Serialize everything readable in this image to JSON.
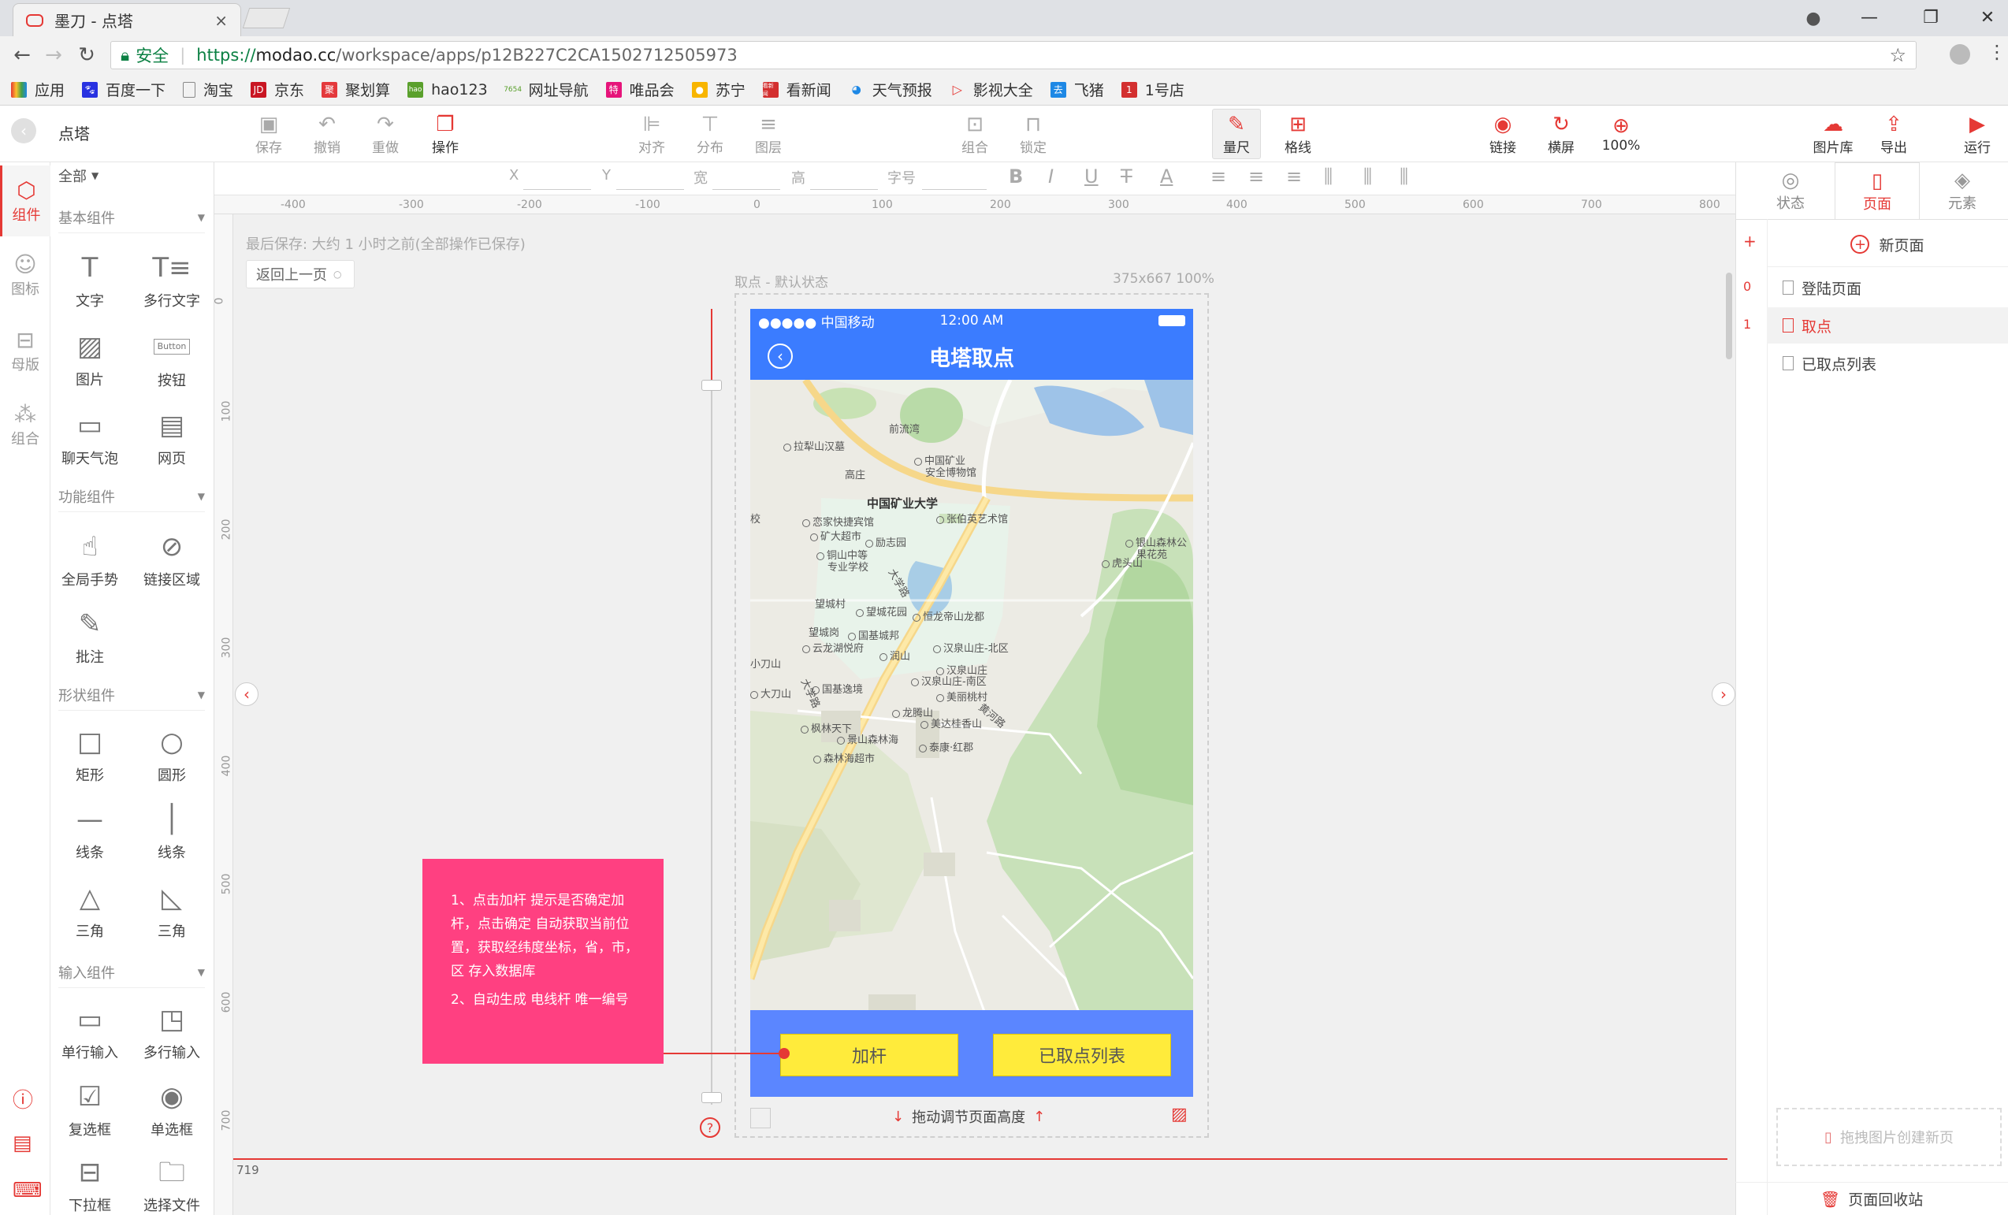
{
  "browser": {
    "tab_title": "墨刀 - 点塔",
    "secure_label": "安全",
    "url_scheme": "https://",
    "url_host": "modao.cc",
    "url_path": "/workspace/apps/p12B227C2CA1502712505973",
    "bookmarks": [
      "应用",
      "百度一下",
      "淘宝",
      "京东",
      "聚划算",
      "hao123",
      "网址导航",
      "唯品会",
      "苏宁",
      "看新闻",
      "天气预报",
      "影视大全",
      "飞猪",
      "1号店"
    ],
    "bookmark_badges": {
      "jd": "JD",
      "juhuasuan": "聚",
      "hao123": "hao",
      "wangzhi": "7654",
      "weipinhui": "特",
      "kanxinwen": "看新闻",
      "feizhu": "去",
      "yihaodian": "1"
    }
  },
  "app": {
    "project_name": "点塔",
    "toolbar": {
      "save": "保存",
      "undo": "撤销",
      "redo": "重做",
      "operate": "操作",
      "align": "对齐",
      "distribute": "分布",
      "layer": "图层",
      "group": "组合",
      "lock": "锁定",
      "ruler": "量尺",
      "grid": "格线",
      "link": "链接",
      "landscape": "横屏",
      "zoom": "100%",
      "image_lib": "图片库",
      "export": "导出",
      "run": "运行"
    },
    "left_tabs": [
      "组件",
      "图标",
      "母版",
      "组合"
    ],
    "filter": "全部",
    "sections": {
      "basic": {
        "title": "基本组件",
        "items": [
          "文字",
          "多行文字",
          "图片",
          "按钮",
          "聊天气泡",
          "网页"
        ],
        "button_icon_text": "Button"
      },
      "function": {
        "title": "功能组件",
        "items": [
          "全局手势",
          "链接区域",
          "批注"
        ]
      },
      "shape": {
        "title": "形状组件",
        "items": [
          "矩形",
          "圆形",
          "线条",
          "线条",
          "三角",
          "三角"
        ]
      },
      "input": {
        "title": "输入组件",
        "items": [
          "单行输入",
          "多行输入",
          "复选框",
          "单选框",
          "下拉框",
          "选择文件"
        ]
      }
    },
    "props": {
      "x": "X",
      "y": "Y",
      "w": "宽",
      "h": "高",
      "font_size": "字号",
      "bold": "B",
      "italic": "I",
      "underline": "U",
      "strike": "T",
      "color": "A"
    },
    "ruler_h": [
      "-400",
      "-300",
      "-200",
      "-100",
      "0",
      "100",
      "200",
      "300",
      "400",
      "500",
      "600",
      "700",
      "800"
    ],
    "ruler_v": [
      "0",
      "100",
      "200",
      "300",
      "400",
      "500",
      "600",
      "700"
    ],
    "save_status": "最后保存: 大约 1 小时之前(全部操作已保存)",
    "back_prev": "返回上一页",
    "artboard_label": "取点 - 默认状态",
    "artboard_size": "375x667 100%",
    "adjust_height": "拖动调节页面高度",
    "height_value": "719",
    "help": "?"
  },
  "phone": {
    "carrier": "●●●●● 中国移动",
    "time": "12:00 AM",
    "title": "电塔取点",
    "map_labels": {
      "qianliuwan": "前流湾",
      "lalishan": "拉犁山汉墓",
      "chinamine_museum_1": "中国矿业",
      "chinamine_museum_2": "安全博物馆",
      "gaozhuang": "高庄",
      "cumt": "中国矿业大学",
      "zhangboying": "张伯英艺术馆",
      "lianjia": "恋家快捷宾馆",
      "kuangda": "矿大超市",
      "lizhiyuan": "励志园",
      "tongshan_school_1": "铜山中等",
      "tongshan_school_2": "专业学校",
      "yinshan_1": "银山森林公",
      "yinshan_2": "果花苑",
      "hushan": "虎头山",
      "daxuelu": "大学路",
      "xiao": "校",
      "wangchengcun": "望城村",
      "wangchenghuayuan": "望城花园",
      "henglong": "恒龙帝山龙都",
      "wangchenggang": "望城岗",
      "guoji": "国基城邦",
      "yunlong": "云龙湖悦府",
      "hanquan_north": "汉泉山庄-北区",
      "runshan": "润山",
      "xiaodashan": "小刀山",
      "hanquan": "汉泉山庄",
      "hanquan_south": "汉泉山庄-南区",
      "guoji_yi": "国基逸境",
      "dadashan": "大刀山",
      "meiyuan": "美丽桃村",
      "longteng": "龙腾山",
      "huanghelu": "黄河路",
      "meidaxing": "美达桂香山",
      "fenglin": "枫林天下",
      "jingshan": "景山森林海",
      "taikang": "泰康·红郡",
      "senlinhai": "森林海超市",
      "daxuelu2": "大学路"
    },
    "btn_add": "加杆",
    "btn_list": "已取点列表"
  },
  "note": {
    "line1": "1、点击加杆 提示是否确定加杆，点击确定 自动获取当前位置，获取经纬度坐标，省，市，区 存入数据库",
    "line2": "2、自动生成 电线杆 唯一编号"
  },
  "right": {
    "tabs": [
      "状态",
      "页面",
      "元素"
    ],
    "new_page": "新页面",
    "pages": [
      "登陆页面",
      "取点",
      "已取点列表"
    ],
    "page_nums": [
      "0",
      "1"
    ],
    "plus": "+",
    "drop_hint": "拖拽图片创建新页",
    "recycle": "页面回收站"
  },
  "colors": {
    "accent": "#e53935",
    "nav_blue": "#3b7cff",
    "note_pink": "#ff4081",
    "button_yellow": "#ffeb3b"
  }
}
